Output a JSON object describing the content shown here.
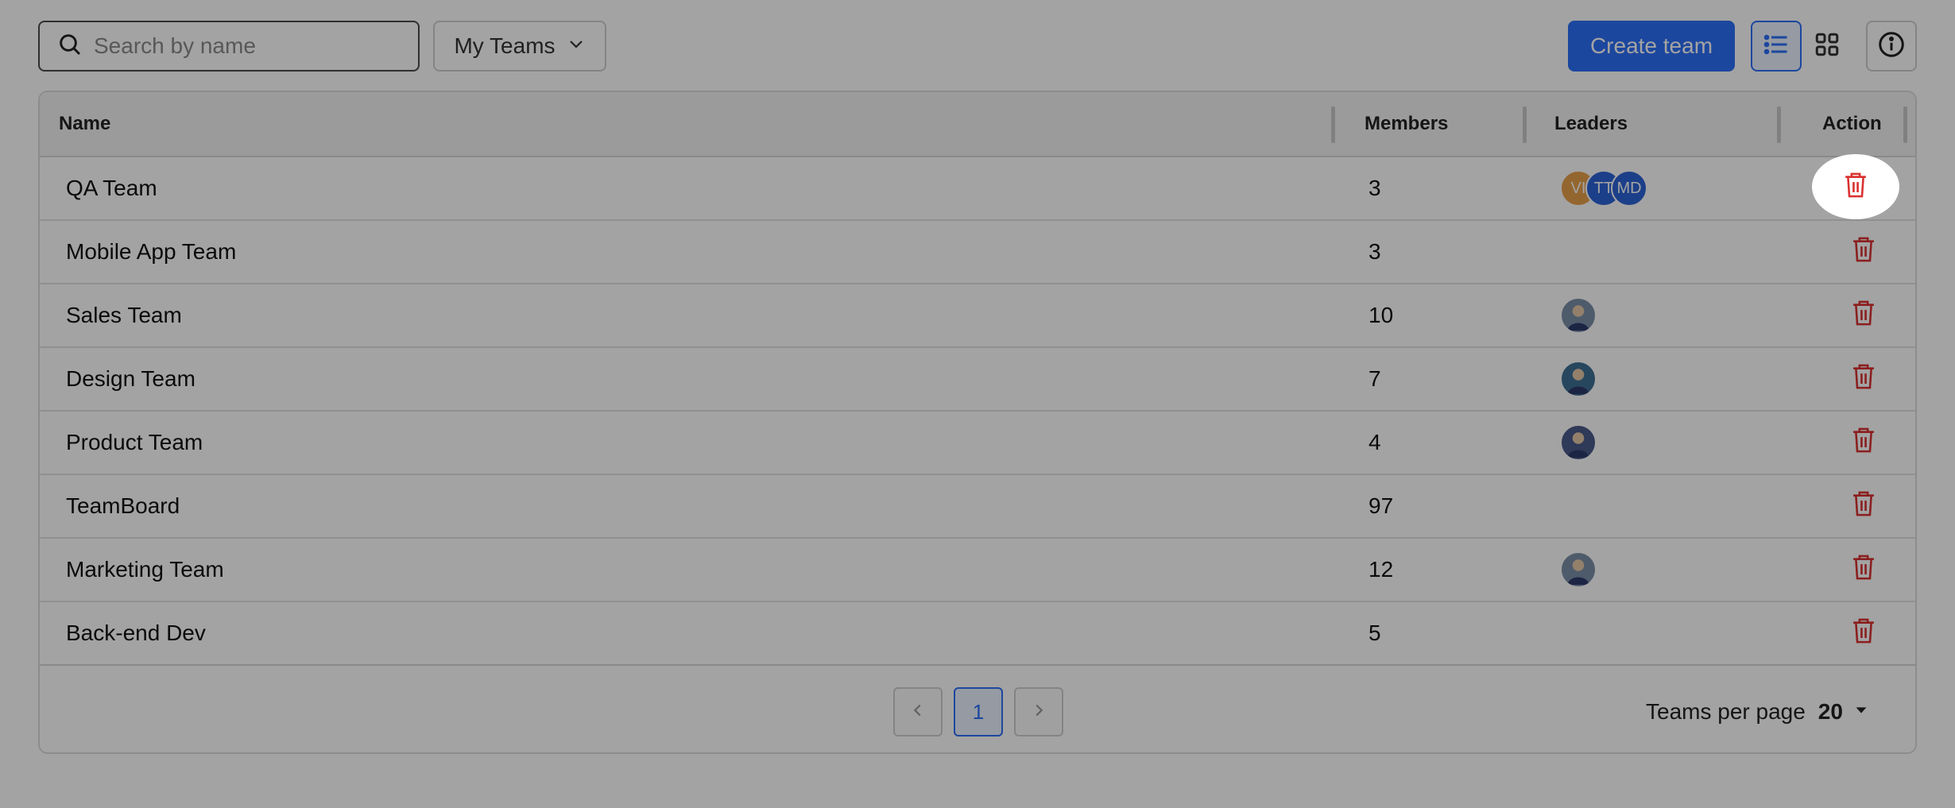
{
  "toolbar": {
    "search_placeholder": "Search by name",
    "team_filter": "My Teams",
    "create_label": "Create team"
  },
  "table": {
    "columns": {
      "name": "Name",
      "members": "Members",
      "leaders": "Leaders",
      "action": "Action"
    },
    "rows": [
      {
        "name": "QA Team",
        "members": "3",
        "leaders": [
          {
            "initials": "VI",
            "color": "#e8a04a"
          },
          {
            "initials": "TT",
            "color": "#2d63d6"
          },
          {
            "initials": "MD",
            "color": "#2d63d6"
          }
        ]
      },
      {
        "name": "Mobile App Team",
        "members": "3",
        "leaders": []
      },
      {
        "name": "Sales Team",
        "members": "10",
        "leaders": [
          {
            "photo": "person-photo"
          }
        ]
      },
      {
        "name": "Design Team",
        "members": "7",
        "leaders": [
          {
            "photo": "person-photo"
          }
        ]
      },
      {
        "name": "Product Team",
        "members": "4",
        "leaders": [
          {
            "photo": "person-photo"
          }
        ]
      },
      {
        "name": "TeamBoard",
        "members": "97",
        "leaders": []
      },
      {
        "name": "Marketing Team",
        "members": "12",
        "leaders": [
          {
            "photo": "person-photo"
          }
        ]
      },
      {
        "name": "Back-end Dev",
        "members": "5",
        "leaders": []
      }
    ]
  },
  "pagination": {
    "current_page": "1",
    "per_page_label": "Teams per page",
    "per_page_value": "20"
  },
  "colors": {
    "accent": "#2d6ff7",
    "danger": "#d9302f",
    "overlay": "rgba(0,0,0,0.36)"
  },
  "icons": {
    "search": "search-icon",
    "chevron": "chevron-down-icon",
    "list": "list-view-icon",
    "grid": "grid-view-icon",
    "info": "info-icon",
    "delete": "trash-icon"
  }
}
